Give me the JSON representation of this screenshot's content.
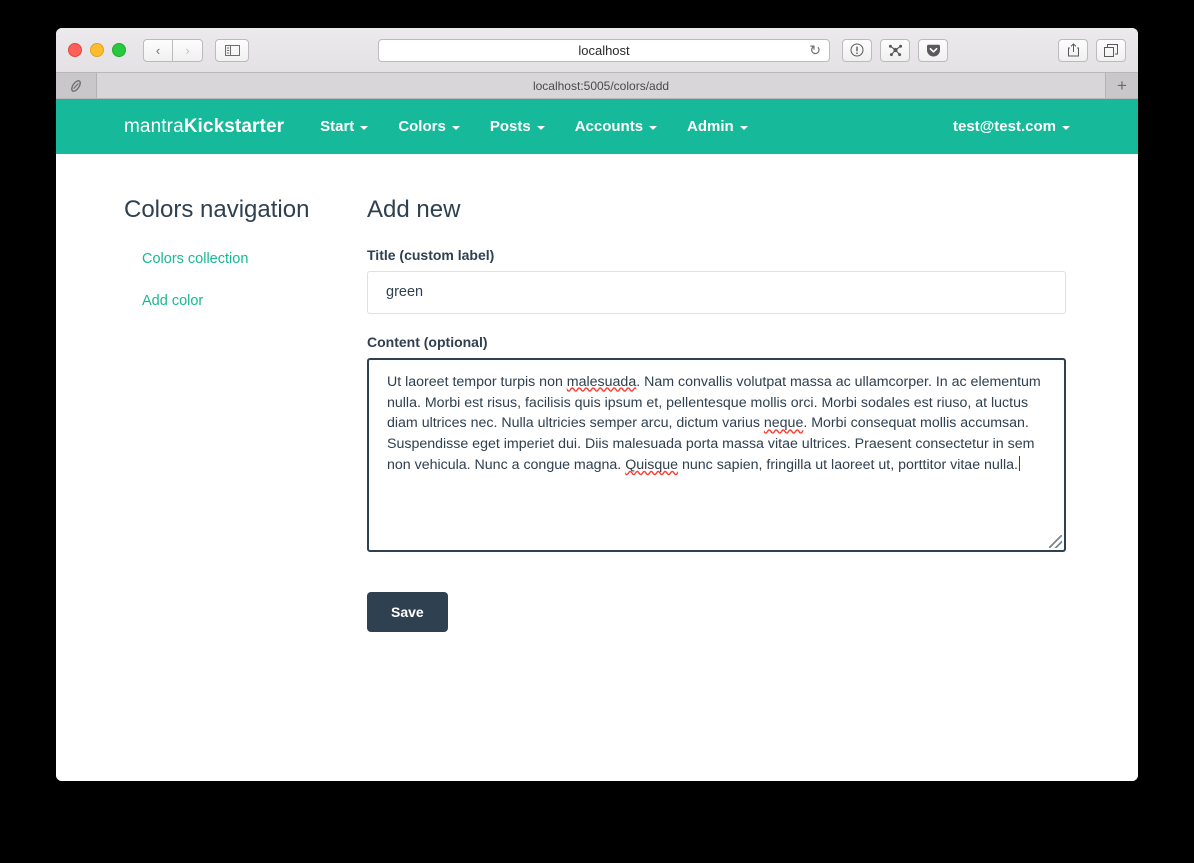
{
  "browser": {
    "traffic_lights": [
      "close",
      "minimize",
      "zoom"
    ],
    "back_label": "‹",
    "forward_label": "›",
    "sidebar_icon": "sidebar-icon",
    "address_value": "localhost",
    "reload_label": "↻",
    "reader_label": "ⓘ",
    "extension_label": "✳",
    "pocket_label": "▼",
    "share_label": "↑",
    "tabs_label": "⧉",
    "tab_title": "localhost:5005/colors/add",
    "new_tab_label": "+"
  },
  "navbar": {
    "brand_light": "mantra",
    "brand_bold": "Kickstarter",
    "items": [
      {
        "label": "Start",
        "has_caret": true
      },
      {
        "label": "Colors",
        "has_caret": true
      },
      {
        "label": "Posts",
        "has_caret": true
      },
      {
        "label": "Accounts",
        "has_caret": true
      },
      {
        "label": "Admin",
        "has_caret": true
      }
    ],
    "user": {
      "label": "test@test.com",
      "has_caret": true
    },
    "background_color": "#16b999"
  },
  "sidebar": {
    "title": "Colors navigation",
    "links": [
      {
        "label": "Colors collection"
      },
      {
        "label": "Add color"
      }
    ],
    "link_color": "#17b894"
  },
  "main": {
    "title": "Add new",
    "title_field": {
      "label": "Title (custom label)",
      "value": "green",
      "placeholder": ""
    },
    "content_field": {
      "label": "Content (optional)",
      "segments": [
        {
          "text": "Ut laoreet tempor turpis non ",
          "spellcheck_error": false
        },
        {
          "text": "malesuada",
          "spellcheck_error": true
        },
        {
          "text": ". Nam convallis volutpat massa ac ullamcorper. In ac elementum nulla. Morbi est risus, facilisis quis ipsum et, pellentesque mollis orci. Morbi sodales est riuso, at luctus diam ultrices nec. Nulla ultricies semper arcu, dictum varius ",
          "spellcheck_error": false
        },
        {
          "text": "neque",
          "spellcheck_error": true
        },
        {
          "text": ". Morbi consequat mollis accumsan. Suspendisse eget imperiet dui. Diis malesuada porta massa vitae ultrices. Praesent consectetur in sem non vehicula. Nunc a congue magna. ",
          "spellcheck_error": false
        },
        {
          "text": "Quisque",
          "spellcheck_error": true
        },
        {
          "text": " nunc sapien, fringilla ut laoreet ut, porttitor vitae nulla.",
          "spellcheck_error": false
        }
      ],
      "value": "Ut laoreet tempor turpis non malesuada. Nam convallis volutpat massa ac ullamcorper. In ac elementum nulla. Morbi est risus, facilisis quis ipsum et, pellentesque mollis orci. Morbi sodales est riuso, at luctus diam ultrices nec. Nulla ultricies semper arcu, dictum varius neque. Morbi consequat mollis accumsan. Suspendisse eget imperiet dui. Diis malesuada porta massa vitae ultrices. Praesent consectetur in sem non vehicula. Nunc a congue magna. Quisque nunc sapien, fringilla ut laoreet ut, porttitor vitae nulla.",
      "focused": true
    },
    "save_label": "Save",
    "save_color": "#2f4050",
    "heading_color": "#2f4050"
  }
}
